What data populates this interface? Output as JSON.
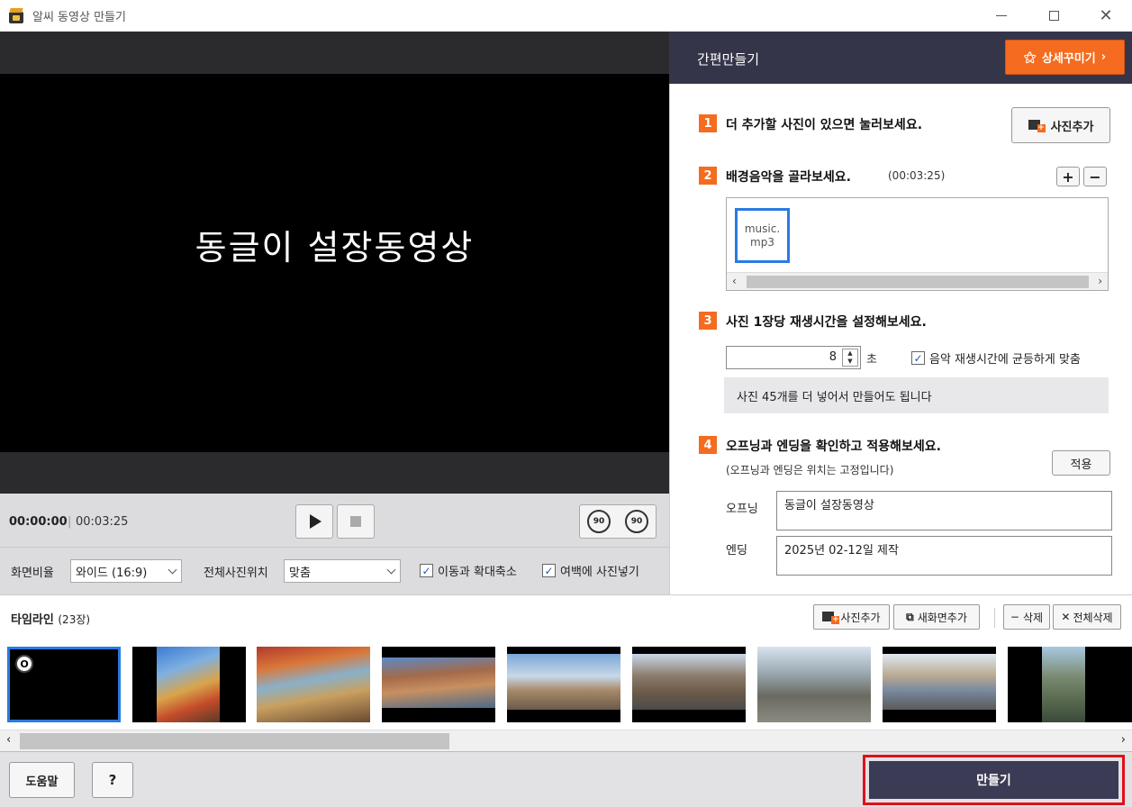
{
  "window": {
    "title": "알씨 동영상 만들기"
  },
  "preview": {
    "overlay_text": "동글이 설장동영상"
  },
  "playback": {
    "current_time": "00:00:00",
    "total_time": "00:03:25",
    "rotate_right_label": "90",
    "rotate_left_label": "90"
  },
  "options": {
    "ratio_label": "화면비율",
    "ratio_value": "와이드 (16:9)",
    "position_label": "전체사진위치",
    "position_value": "맞춤",
    "motion_label": "이동과 확대축소",
    "motion_checked": true,
    "margin_label": "여백에 사진넣기",
    "margin_checked": true
  },
  "panel": {
    "title": "간편만들기",
    "detail_button": "상세꾸미기",
    "step1": {
      "num": "1",
      "title": "더 추가할 사진이 있으면 눌러보세요.",
      "button": "사진추가"
    },
    "step2": {
      "num": "2",
      "title": "배경음악을 골라보세요.",
      "duration": "(00:03:25)",
      "files": [
        "music.",
        "mp3"
      ]
    },
    "step3": {
      "num": "3",
      "title": "사진 1장당 재생시간을 설정해보세요.",
      "seconds": "8",
      "unit": "초",
      "fit_label": "음악 재생시간에 균등하게 맞춤",
      "fit_checked": true,
      "info": "사진 45개를 더 넣어서 만들어도 됩니다"
    },
    "step4": {
      "num": "4",
      "title": "오프닝과 엔딩을 확인하고 적용해보세요.",
      "sub": "(오프닝과 엔딩은 위치는 고정입니다)",
      "apply_button": "적용",
      "opening_label": "오프닝",
      "opening_value": "동글이 설장동영상",
      "ending_label": "엔딩",
      "ending_value": "2025년 02-12일 제작"
    }
  },
  "timeline": {
    "title": "타임라인",
    "count": "(23장)",
    "add_photo": "사진추가",
    "add_screen": "새화면추가",
    "delete": "삭제",
    "delete_all": "전체삭제",
    "first_badge": "O"
  },
  "bottom": {
    "help": "도움말",
    "question": "?",
    "make": "만들기"
  },
  "colors": {
    "accent": "#f56b1f",
    "header": "#35354a",
    "select": "#2a7ae2",
    "make_button": "#3b3b55",
    "highlight": "#e0101a"
  }
}
